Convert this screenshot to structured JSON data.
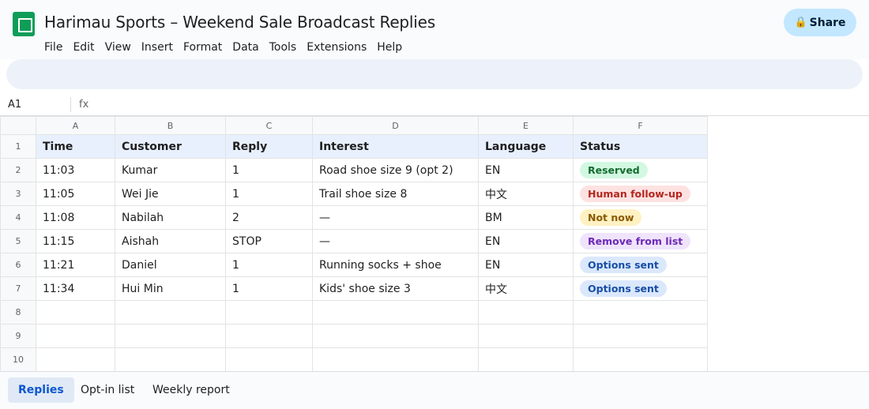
{
  "app": {
    "title": "Harimau Sports – Weekend Sale Broadcast Replies",
    "logo_icon": "sheets-logo-icon",
    "share_label": "Share",
    "share_icon": "🔒"
  },
  "menu": [
    "File",
    "Edit",
    "View",
    "Insert",
    "Format",
    "Data",
    "Tools",
    "Extensions",
    "Help"
  ],
  "formula_bar": {
    "cell_ref": "A1",
    "fx_label": "fx"
  },
  "columns": [
    "A",
    "B",
    "C",
    "D",
    "E",
    "F"
  ],
  "row_numbers": [
    "1",
    "2",
    "3",
    "4",
    "5",
    "6",
    "7",
    "8",
    "9",
    "10"
  ],
  "table": {
    "headers": [
      "Time",
      "Customer",
      "Reply",
      "Interest",
      "Language",
      "Status"
    ],
    "rows": [
      {
        "time": "11:03",
        "customer": "Kumar",
        "reply": "1",
        "interest": "Road shoe size 9 (opt 2)",
        "language": "EN",
        "status": "Reserved"
      },
      {
        "time": "11:05",
        "customer": "Wei Jie",
        "reply": "1",
        "interest": "Trail shoe size 8",
        "language": "中文",
        "status": "Human follow-up"
      },
      {
        "time": "11:08",
        "customer": "Nabilah",
        "reply": "2",
        "interest": "—",
        "language": "BM",
        "status": "Not now"
      },
      {
        "time": "11:15",
        "customer": "Aishah",
        "reply": "STOP",
        "interest": "—",
        "language": "EN",
        "status": "Remove from list"
      },
      {
        "time": "11:21",
        "customer": "Daniel",
        "reply": "1",
        "interest": "Running socks + shoe",
        "language": "EN",
        "status": "Options sent"
      },
      {
        "time": "11:34",
        "customer": "Hui Min",
        "reply": "1",
        "interest": "Kids' shoe size 3",
        "language": "中文",
        "status": "Options sent"
      }
    ]
  },
  "status_colors": {
    "Reserved": {
      "bg": "#d3f8e2",
      "fg": "#146c2e"
    },
    "Human follow-up": {
      "bg": "#fde2e1",
      "fg": "#b3261e"
    },
    "Not now": {
      "bg": "#fff1c2",
      "fg": "#8a5a00"
    },
    "Remove from list": {
      "bg": "#efe4fb",
      "fg": "#6d28b8"
    },
    "Options sent": {
      "bg": "#dbe8fc",
      "fg": "#174ea6"
    }
  },
  "sheet_tabs": [
    {
      "label": "Replies",
      "active": true
    },
    {
      "label": "Opt-in list",
      "active": false
    },
    {
      "label": "Weekly report",
      "active": false
    }
  ]
}
